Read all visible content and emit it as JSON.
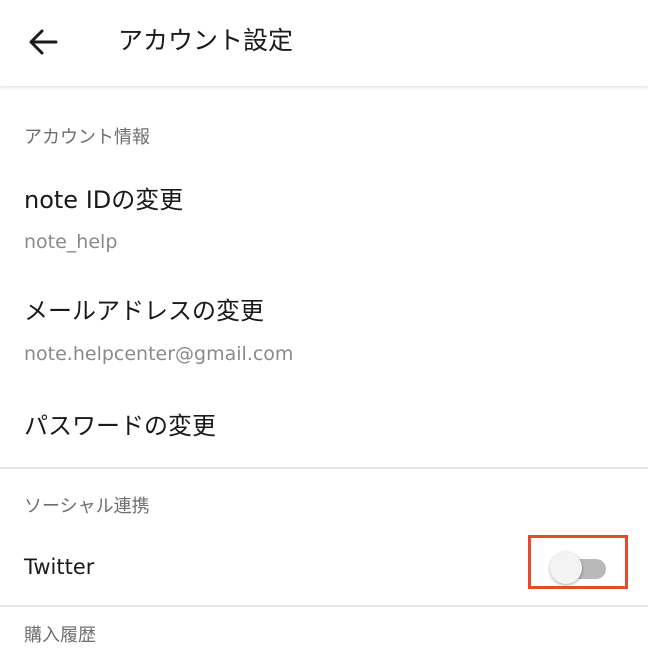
{
  "header": {
    "title": "アカウント設定",
    "back_icon": "arrow-left-icon"
  },
  "account_info": {
    "section_label": "アカウント情報",
    "note_id": {
      "label": "note IDの変更",
      "value": "note_help"
    },
    "email": {
      "label": "メールアドレスの変更",
      "value": "note.helpcenter@gmail.com"
    },
    "password": {
      "label": "パスワードの変更"
    }
  },
  "social": {
    "section_label": "ソーシャル連携",
    "twitter": {
      "label": "Twitter",
      "enabled": false
    }
  },
  "next_section": {
    "label": "購入履歴"
  },
  "colors": {
    "highlight": "#e8492e",
    "toggle_track_off": "#b9b9b9",
    "toggle_knob": "#f3f3f3",
    "secondary_text": "#8a8a8a"
  }
}
